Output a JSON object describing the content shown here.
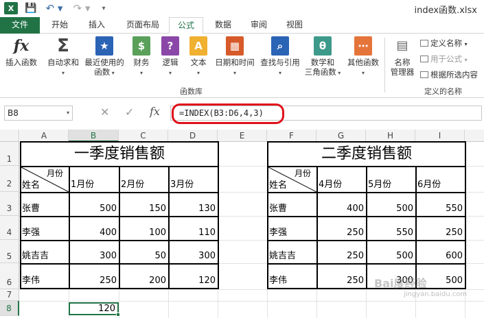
{
  "titlebar": {
    "app_logo": "X",
    "save_icon": "💾",
    "undo_icon": "↶ ▾",
    "redo_icon": "↷ ▾",
    "more_icon": "▾",
    "doc_title": "index函数.xlsx"
  },
  "tabs": [
    "文件",
    "开始",
    "插入",
    "页面布局",
    "公式",
    "数据",
    "审阅",
    "视图"
  ],
  "ribbon": {
    "insert_function": "插入函数",
    "autosum": "自动求和",
    "recent_1": "最近使用的",
    "recent_2": "函数",
    "financial": "财务",
    "logical": "逻辑",
    "text": "文本",
    "datetime": "日期和时间",
    "lookup": "查找与引用",
    "math_1": "数学和",
    "math_2": "三角函数",
    "more": "其他函数",
    "group_library": "函数库",
    "name_manager_1": "名称",
    "name_manager_2": "管理器",
    "define_name": "定义名称",
    "use_in_formula": "用于公式",
    "create_from_selection": "根据所选内容",
    "group_names": "定义的名称"
  },
  "formula_bar": {
    "name_box": "B8",
    "formula": "=INDEX(B3:D6,4,3)"
  },
  "columns": [
    "A",
    "B",
    "C",
    "D",
    "E",
    "F",
    "G",
    "H",
    "I"
  ],
  "rows": [
    "1",
    "2",
    "3",
    "4",
    "5",
    "6",
    "7",
    "8"
  ],
  "table_q1": {
    "title": "一季度销售额",
    "corner_top": "月份",
    "corner_bottom": "姓名",
    "months": [
      "1月份",
      "2月份",
      "3月份"
    ],
    "rows": [
      {
        "name": "张曹",
        "values": [
          "500",
          "150",
          "130"
        ]
      },
      {
        "name": "李强",
        "values": [
          "400",
          "100",
          "110"
        ]
      },
      {
        "name": "姚吉吉",
        "values": [
          "300",
          "50",
          "300"
        ]
      },
      {
        "name": "李伟",
        "values": [
          "250",
          "200",
          "120"
        ]
      }
    ]
  },
  "table_q2": {
    "title": "二季度销售额",
    "corner_top": "月份",
    "corner_bottom": "姓名",
    "months": [
      "4月份",
      "5月份",
      "6月份"
    ],
    "rows": [
      {
        "name": "张曹",
        "values": [
          "400",
          "500",
          "550"
        ]
      },
      {
        "name": "李强",
        "values": [
          "250",
          "550",
          "250"
        ]
      },
      {
        "name": "姚吉吉",
        "values": [
          "250",
          "500",
          "600"
        ]
      },
      {
        "name": "李伟",
        "values": [
          "250",
          "300",
          "500"
        ]
      }
    ]
  },
  "result": "120",
  "watermark": "Bai度经验",
  "watermark_sub": "jingyan.baidu.com",
  "colors": {
    "accent": "#217346",
    "highlight": "#e0101a"
  }
}
